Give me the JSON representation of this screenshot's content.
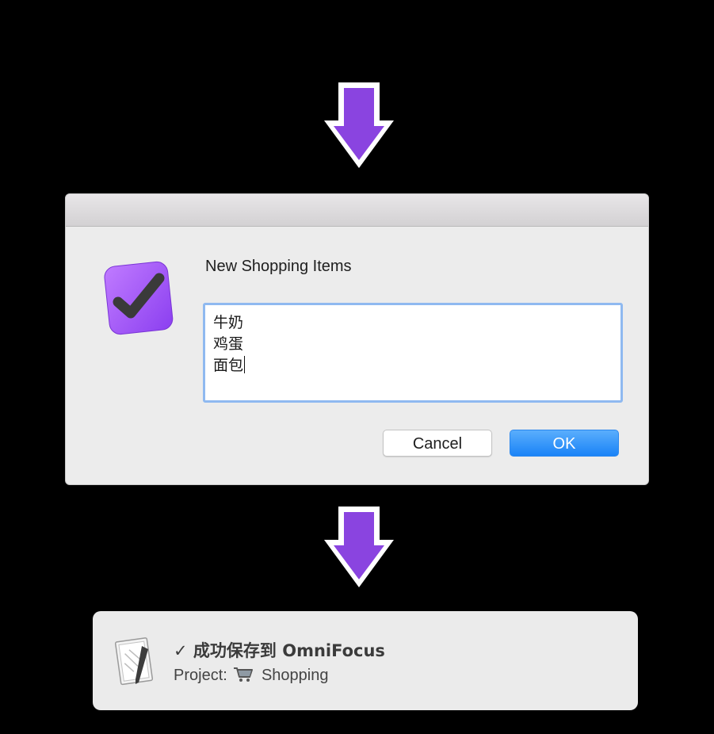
{
  "dialog": {
    "prompt": "New Shopping Items",
    "text_lines": [
      "牛奶",
      "鸡蛋",
      "面包"
    ],
    "cancel_label": "Cancel",
    "ok_label": "OK"
  },
  "notification": {
    "title": "✓ 成功保存到 OmniFocus",
    "project_label": "Project:",
    "project_name": "Shopping"
  },
  "colors": {
    "arrow": "#8a44e0",
    "accent": "#1a83f7",
    "background": "#000000"
  },
  "icons": [
    "down-arrow-icon",
    "omnifocus-app-icon",
    "shopping-cart-icon",
    "script-editor-icon"
  ]
}
